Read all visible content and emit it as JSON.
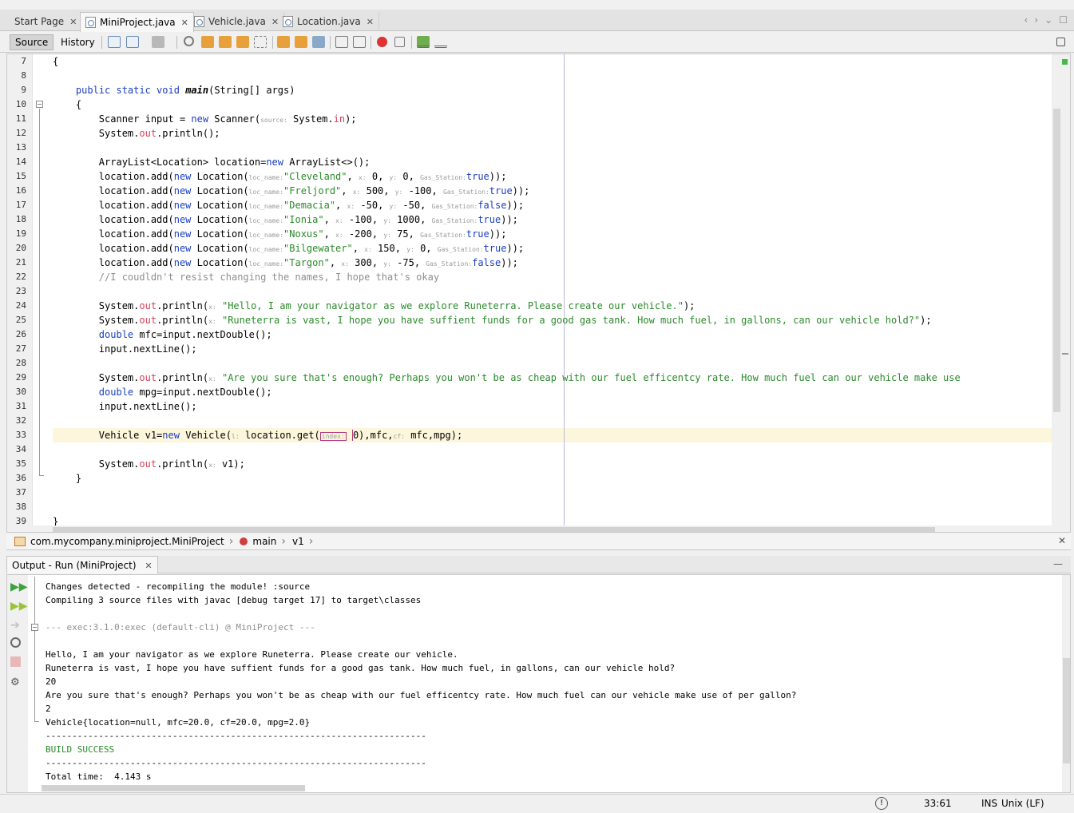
{
  "tabs": [
    {
      "label": "Start Page"
    },
    {
      "label": "MiniProject.java"
    },
    {
      "label": "Vehicle.java"
    },
    {
      "label": "Location.java"
    }
  ],
  "toolbar": {
    "source_label": "Source",
    "history_label": "History"
  },
  "editor": {
    "line_numbers": [
      "7",
      "8",
      "9",
      "10",
      "11",
      "12",
      "13",
      "14",
      "15",
      "16",
      "17",
      "18",
      "19",
      "20",
      "21",
      "22",
      "23",
      "24",
      "25",
      "26",
      "27",
      "28",
      "29",
      "30",
      "31",
      "32",
      "33",
      "34",
      "35",
      "36",
      "37",
      "38",
      "39"
    ],
    "current_line": "33",
    "hint_labels": {
      "source": "source:",
      "loc_name": "loc_name:",
      "x": "x:",
      "y": "y:",
      "gas_station": "Gas_Station:",
      "index": "index:",
      "l": "l:",
      "cf": "cf:"
    },
    "comment": "//I coudldn't resist changing the names, I hope that's okay",
    "strings": {
      "hello": "\"Hello, I am your navigator as we explore Runeterra. Please create our vehicle.\"",
      "vast": "\"Runeterra is vast, I hope you have suffient funds for a good gas tank. How much fuel, in gallons, can our vehicle hold?\"",
      "enough": "\"Are you sure that's enough? Perhaps you won't be as cheap with our fuel efficentcy rate. How much fuel can our vehicle make use"
    },
    "locations": [
      {
        "name": "\"Cleveland\"",
        "x": "0",
        "y": "0",
        "gas": "true"
      },
      {
        "name": "\"Freljord\"",
        "x": "500",
        "y": "-100",
        "gas": "true"
      },
      {
        "name": "\"Demacia\"",
        "x": "-50",
        "y": "-50",
        "gas": "false"
      },
      {
        "name": "\"Ionia\"",
        "x": "-100",
        "y": "1000",
        "gas": "true"
      },
      {
        "name": "\"Noxus\"",
        "x": "-200",
        "y": "75",
        "gas": "true"
      },
      {
        "name": "\"Bilgewater\"",
        "x": "150",
        "y": "0",
        "gas": "true"
      },
      {
        "name": "\"Targon\"",
        "x": "300",
        "y": "-75",
        "gas": "false"
      }
    ]
  },
  "breadcrumbs": [
    "com.mycompany.miniproject.MiniProject",
    "main",
    "v1"
  ],
  "output": {
    "tab_label": "Output - Run (MiniProject)",
    "lines": [
      "Changes detected - recompiling the module! :source",
      "Compiling 3 source files with javac [debug target 17] to target\\classes",
      "--- exec:3.1.0:exec (default-cli) @ MiniProject ---",
      "Hello, I am your navigator as we explore Runeterra. Please create our vehicle.",
      "Runeterra is vast, I hope you have suffient funds for a good gas tank. How much fuel, in gallons, can our vehicle hold?",
      "20",
      "Are you sure that's enough? Perhaps you won't be as cheap with our fuel efficentcy rate. How much fuel can our vehicle make use of per gallon?",
      "2",
      "Vehicle{location=null, mfc=20.0, cf=20.0, mpg=2.0}",
      "------------------------------------------------------------------------",
      "BUILD SUCCESS",
      "------------------------------------------------------------------------",
      "Total time:  4.143 s"
    ]
  },
  "status": {
    "position": "33:61",
    "mode": "INS",
    "line_ending": "Unix (LF)"
  },
  "colors": {
    "keyword": "#1a3ec2",
    "string": "#2a8a2a",
    "field": "#d7425b",
    "comment": "#8e8e8e",
    "current_line": "#fcf6dc"
  }
}
